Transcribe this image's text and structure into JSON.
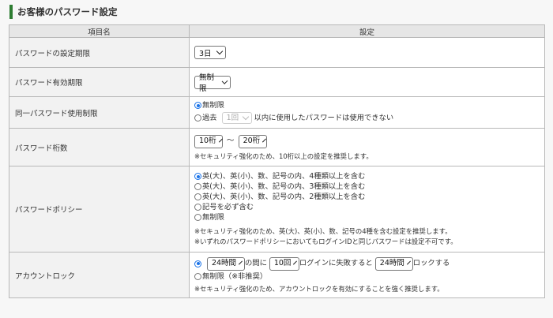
{
  "section": {
    "title": "お客様のパスワード設定"
  },
  "table": {
    "header_item": "項目名",
    "header_setting": "設定"
  },
  "expiry_setting": {
    "label": "パスワードの設定期限",
    "selected": "3日"
  },
  "validity": {
    "label": "パスワード有効期限",
    "selected": "無制限"
  },
  "reuse": {
    "label": "同一パスワード使用制限",
    "option_unlimited": "無制限",
    "option_past": "過去",
    "past_select": "1回",
    "past_suffix": "以内に使用したパスワードは使用できない"
  },
  "digits": {
    "label": "パスワード桁数",
    "min": "10桁",
    "separator": "～",
    "max": "20桁",
    "note": "※セキュリティ強化のため、10桁以上の設定を推奨します。"
  },
  "policy": {
    "label": "パスワードポリシー",
    "options": [
      "英(大)、英(小)、数、記号の内、4種類以上を含む",
      "英(大)、英(小)、数、記号の内、3種類以上を含む",
      "英(大)、英(小)、数、記号の内、2種類以上を含む",
      "記号を必ず含む",
      "無制限"
    ],
    "note1": "※セキュリティ強化のため、英(大)、英(小)、数、記号の4種を含む設定を推奨します。",
    "note2": "※いずれのパスワードポリシーにおいてもログインIDと同じパスワードは設定不可です。"
  },
  "lockout": {
    "label": "アカウントロック",
    "period": "24時間",
    "text_between": "の間に",
    "count": "10回",
    "text_fail": "ログインに失敗すると",
    "lock_duration": "24時間",
    "text_lock": "ロックする",
    "option_unlimited": "無制限（※非推奨）",
    "note": "※セキュリティ強化のため、アカウントロックを有効にすることを強く推奨します。"
  },
  "colors": {
    "accent_bar": "#2e7d32",
    "radio_selected": "#1a73e8",
    "header_bg": "#e6e6e6",
    "label_bg": "#f2f2f2"
  }
}
